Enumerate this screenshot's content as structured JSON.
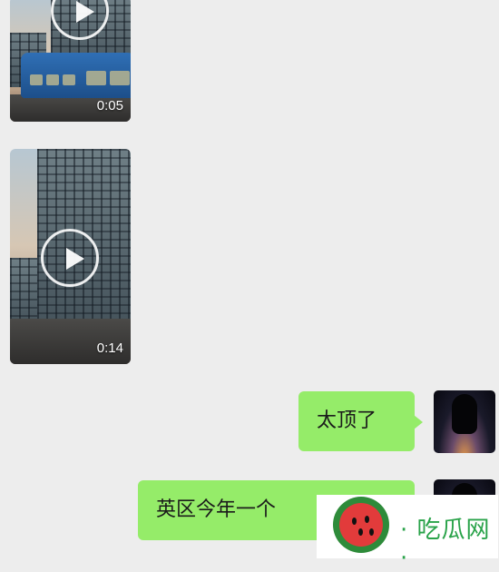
{
  "messages": [
    {
      "type": "video",
      "duration": "0:05",
      "side": "left"
    },
    {
      "type": "video",
      "duration": "0:14",
      "side": "left"
    },
    {
      "type": "text",
      "text": "太顶了",
      "side": "right"
    },
    {
      "type": "text",
      "text": "英区今年一个",
      "side": "right"
    }
  ],
  "watermark": {
    "text": "· 吃瓜网 ·"
  },
  "colors": {
    "background": "#ededed",
    "bubble": "#95ec69",
    "watermark_green": "#2aa34a"
  },
  "icons": {
    "play": "play-icon",
    "watermark_logo": "watermelon-icon"
  }
}
